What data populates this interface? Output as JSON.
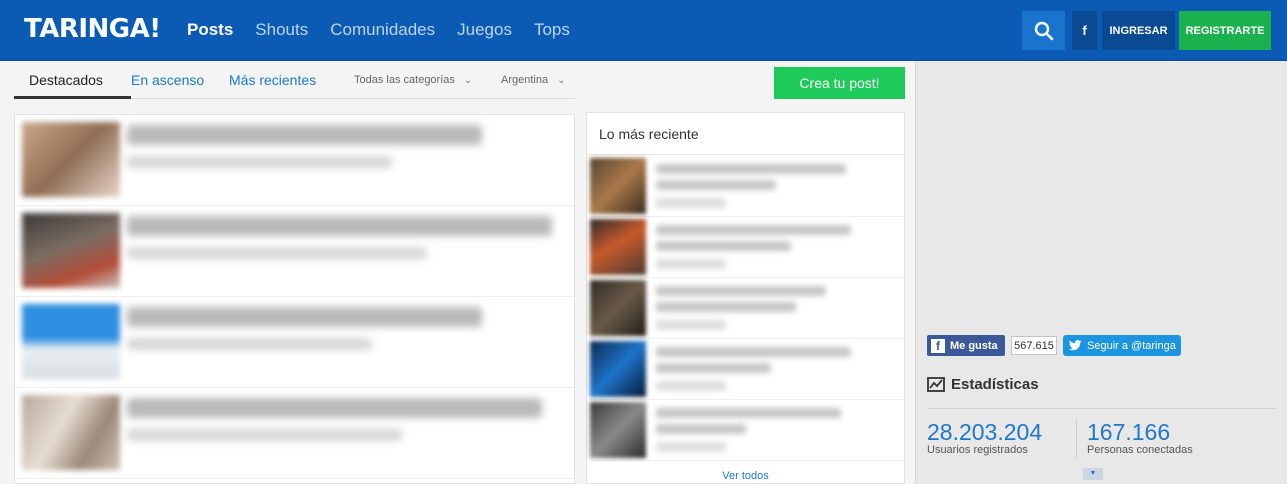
{
  "header": {
    "logo": "TARINGA!",
    "nav": [
      "Posts",
      "Shouts",
      "Comunidades",
      "Juegos",
      "Tops"
    ],
    "facebook_label": "f",
    "login_label": "INGRESAR",
    "register_label": "REGISTRARTE"
  },
  "tabs": {
    "items": [
      "Destacados",
      "En ascenso",
      "Más recientes"
    ],
    "category_filter": "Todas las categorías",
    "country_filter": "Argentina"
  },
  "create_post_label": "Crea tu post!",
  "recent": {
    "title": "Lo más reciente",
    "see_all": "Ver todos"
  },
  "social": {
    "fb_like_label": "Me gusta",
    "fb_count": "567.615",
    "twitter_label": "Seguir a @taringa"
  },
  "stats": {
    "title": "Estadísticas",
    "registered_value": "28.203.204",
    "registered_label": "Usuarios registrados",
    "online_value": "167.166",
    "online_label": "Personas conectadas"
  },
  "colors": {
    "header_bg": "#0b5bb5",
    "accent_blue": "#1e78c8",
    "green": "#1bb14e"
  }
}
